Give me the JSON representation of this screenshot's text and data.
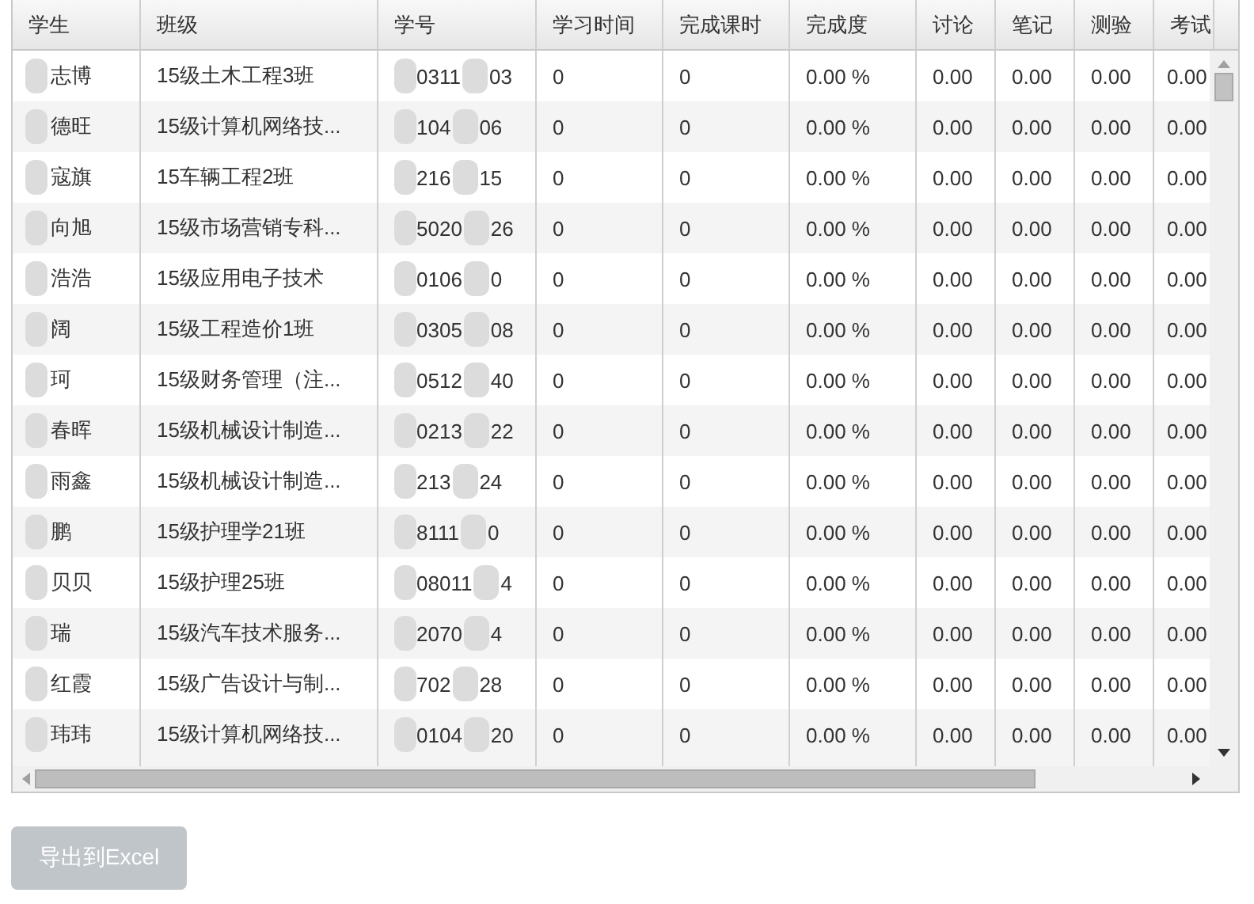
{
  "table": {
    "columns": [
      "学生",
      "班级",
      "学号",
      "学习时间",
      "完成课时",
      "完成度",
      "讨论",
      "笔记",
      "测验",
      "考试"
    ],
    "rows": [
      {
        "student": "志博",
        "class": "15级土木工程3班",
        "id_start": "0311",
        "id_end": "03",
        "study_time": "0",
        "hours": "0",
        "completion": "0.00 %",
        "discussion": "0.00",
        "notes": "0.00",
        "quiz": "0.00",
        "exam": "0.00"
      },
      {
        "student": "德旺",
        "class": "15级计算机网络技...",
        "id_start": "104",
        "id_end": "06",
        "study_time": "0",
        "hours": "0",
        "completion": "0.00 %",
        "discussion": "0.00",
        "notes": "0.00",
        "quiz": "0.00",
        "exam": "0.00"
      },
      {
        "student": "寇旗",
        "class": "15车辆工程2班",
        "id_start": "216",
        "id_end": "15",
        "study_time": "0",
        "hours": "0",
        "completion": "0.00 %",
        "discussion": "0.00",
        "notes": "0.00",
        "quiz": "0.00",
        "exam": "0.00"
      },
      {
        "student": "向旭",
        "class": "15级市场营销专科...",
        "id_start": "5020",
        "id_end": "26",
        "study_time": "0",
        "hours": "0",
        "completion": "0.00 %",
        "discussion": "0.00",
        "notes": "0.00",
        "quiz": "0.00",
        "exam": "0.00"
      },
      {
        "student": "浩浩",
        "class": "15级应用电子技术",
        "id_start": "0106",
        "id_end": "0",
        "study_time": "0",
        "hours": "0",
        "completion": "0.00 %",
        "discussion": "0.00",
        "notes": "0.00",
        "quiz": "0.00",
        "exam": "0.00"
      },
      {
        "student": "阔",
        "class": "15级工程造价1班",
        "id_start": "0305",
        "id_end": "08",
        "study_time": "0",
        "hours": "0",
        "completion": "0.00 %",
        "discussion": "0.00",
        "notes": "0.00",
        "quiz": "0.00",
        "exam": "0.00"
      },
      {
        "student": "珂",
        "class": "15级财务管理（注...",
        "id_start": "0512",
        "id_end": "40",
        "study_time": "0",
        "hours": "0",
        "completion": "0.00 %",
        "discussion": "0.00",
        "notes": "0.00",
        "quiz": "0.00",
        "exam": "0.00"
      },
      {
        "student": "春晖",
        "class": "15级机械设计制造...",
        "id_start": "0213",
        "id_end": "22",
        "study_time": "0",
        "hours": "0",
        "completion": "0.00 %",
        "discussion": "0.00",
        "notes": "0.00",
        "quiz": "0.00",
        "exam": "0.00"
      },
      {
        "student": "雨鑫",
        "class": "15级机械设计制造...",
        "id_start": "213",
        "id_end": "24",
        "study_time": "0",
        "hours": "0",
        "completion": "0.00 %",
        "discussion": "0.00",
        "notes": "0.00",
        "quiz": "0.00",
        "exam": "0.00"
      },
      {
        "student": "鹏",
        "class": "15级护理学21班",
        "id_start": "8111",
        "id_end": "0",
        "study_time": "0",
        "hours": "0",
        "completion": "0.00 %",
        "discussion": "0.00",
        "notes": "0.00",
        "quiz": "0.00",
        "exam": "0.00"
      },
      {
        "student": "贝贝",
        "class": "15级护理25班",
        "id_start": "08011",
        "id_end": "4",
        "study_time": "0",
        "hours": "0",
        "completion": "0.00 %",
        "discussion": "0.00",
        "notes": "0.00",
        "quiz": "0.00",
        "exam": "0.00"
      },
      {
        "student": "瑞",
        "class": "15级汽车技术服务...",
        "id_start": "2070",
        "id_end": "4",
        "study_time": "0",
        "hours": "0",
        "completion": "0.00 %",
        "discussion": "0.00",
        "notes": "0.00",
        "quiz": "0.00",
        "exam": "0.00"
      },
      {
        "student": "红霞",
        "class": "15级广告设计与制...",
        "id_start": "702",
        "id_end": "28",
        "study_time": "0",
        "hours": "0",
        "completion": "0.00 %",
        "discussion": "0.00",
        "notes": "0.00",
        "quiz": "0.00",
        "exam": "0.00"
      },
      {
        "student": "玮玮",
        "class": "15级计算机网络技...",
        "id_start": "0104",
        "id_end": "20",
        "study_time": "0",
        "hours": "0",
        "completion": "0.00 %",
        "discussion": "0.00",
        "notes": "0.00",
        "quiz": "0.00",
        "exam": "0.00"
      }
    ]
  },
  "export_button": "导出到Excel"
}
